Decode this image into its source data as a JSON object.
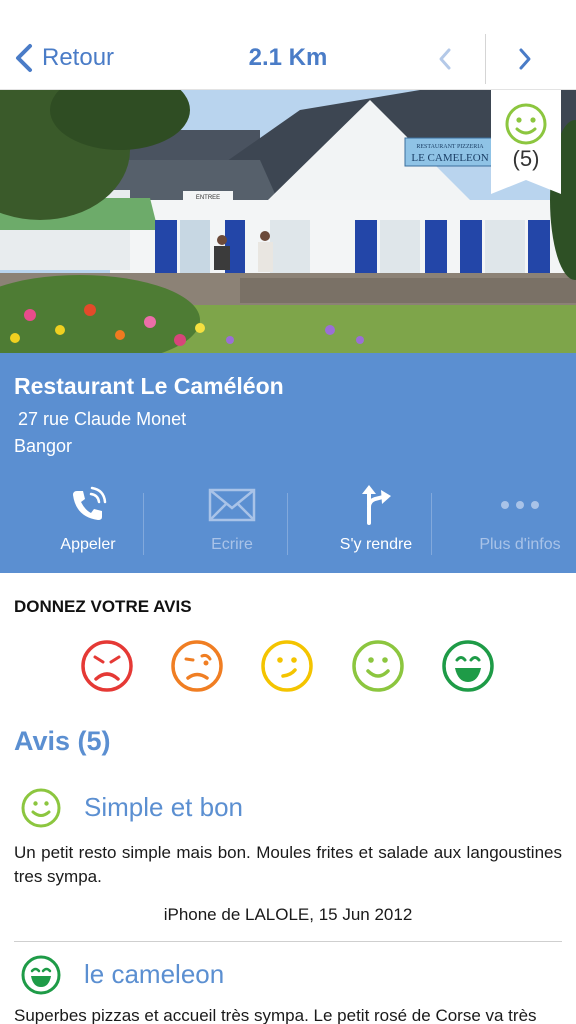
{
  "nav": {
    "back_label": "Retour",
    "distance": "2.1 Km"
  },
  "photo": {
    "sign_line1": "RESTAURANT  PIZZERIA",
    "sign_line2": "LE CAMELEON",
    "sign_small": "ENTREE",
    "page_count": 2,
    "current_page": 1
  },
  "rating_badge": {
    "count": "(5)",
    "color": "#8cc63f"
  },
  "place": {
    "name": "Restaurant Le Caméléon",
    "address_line1": "27 rue Claude Monet",
    "address_line2": "Bangor",
    "panel_color": "#5b8fd1"
  },
  "actions": [
    {
      "label": "Appeler",
      "icon": "phone-icon",
      "enabled": true
    },
    {
      "label": "Ecrire",
      "icon": "mail-icon",
      "enabled": false
    },
    {
      "label": "S'y rendre",
      "icon": "directions-icon",
      "enabled": true
    },
    {
      "label": "Plus d'infos",
      "icon": "more-icon",
      "enabled": false
    }
  ],
  "prompt": {
    "title": "DONNEZ VOTRE AVIS",
    "faces": [
      {
        "icon": "very-sad-face-icon",
        "color": "#e53935"
      },
      {
        "icon": "sad-face-icon",
        "color": "#f07e23"
      },
      {
        "icon": "neutral-face-icon",
        "color": "#f4c400"
      },
      {
        "icon": "happy-face-icon",
        "color": "#8cc63f"
      },
      {
        "icon": "very-happy-face-icon",
        "color": "#1e9b47"
      }
    ]
  },
  "reviews": {
    "title": "Avis (5)",
    "items": [
      {
        "icon": "happy-face-icon",
        "color": "#8cc63f",
        "title": "Simple et bon",
        "text": "Un petit resto simple mais bon. Moules frites et salade aux langoustines tres sympa.",
        "author": "iPhone de LALOLE, 15 Jun 2012"
      },
      {
        "icon": "very-happy-face-icon",
        "color": "#1e9b47",
        "title": "le cameleon",
        "text": "Superbes pizzas et accueil très sympa. Le petit rosé de Corse va très"
      }
    ]
  }
}
